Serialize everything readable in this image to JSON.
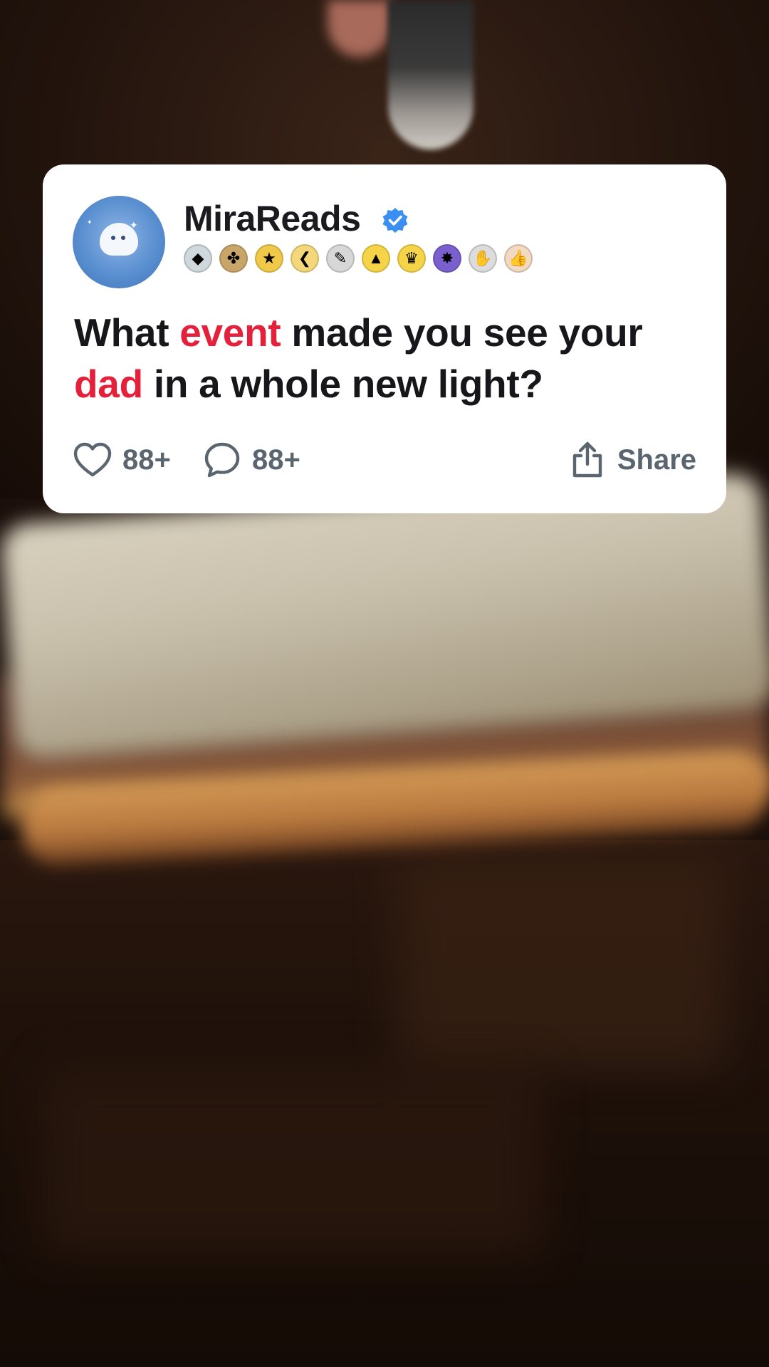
{
  "post": {
    "username": "MiraReads",
    "verified": true,
    "badges": [
      {
        "icon": "gem-badge",
        "glyph": "◆",
        "bg": "#cfd8dc"
      },
      {
        "icon": "clover-badge",
        "glyph": "✤",
        "bg": "#c8a66a"
      },
      {
        "icon": "star-badge",
        "glyph": "★",
        "bg": "#f0c94a"
      },
      {
        "icon": "boomerang-badge",
        "glyph": "❮",
        "bg": "#f3d77a"
      },
      {
        "icon": "feather-badge",
        "glyph": "✎",
        "bg": "#d7d7d7"
      },
      {
        "icon": "pyramid-badge",
        "glyph": "▲",
        "bg": "#f5d547"
      },
      {
        "icon": "trophy-badge",
        "glyph": "♛",
        "bg": "#f5d547"
      },
      {
        "icon": "burst-badge",
        "glyph": "✸",
        "bg": "#7a5fcf"
      },
      {
        "icon": "clap-badge",
        "glyph": "✋",
        "bg": "#dcdcdc"
      },
      {
        "icon": "thumbs-up-badge",
        "glyph": "👍",
        "bg": "#f2d9c2"
      }
    ],
    "question_parts": [
      {
        "text": "What ",
        "highlight": false
      },
      {
        "text": "event",
        "highlight": true
      },
      {
        "text": " made you see your ",
        "highlight": false
      },
      {
        "text": "dad",
        "highlight": true
      },
      {
        "text": " in a whole new light?",
        "highlight": false
      }
    ],
    "likes": "88+",
    "comments": "88+",
    "share_label": "Share"
  },
  "colors": {
    "highlight": "#e4203a",
    "text": "#17171b",
    "muted": "#5b6570",
    "verified": "#3b8ff0"
  }
}
